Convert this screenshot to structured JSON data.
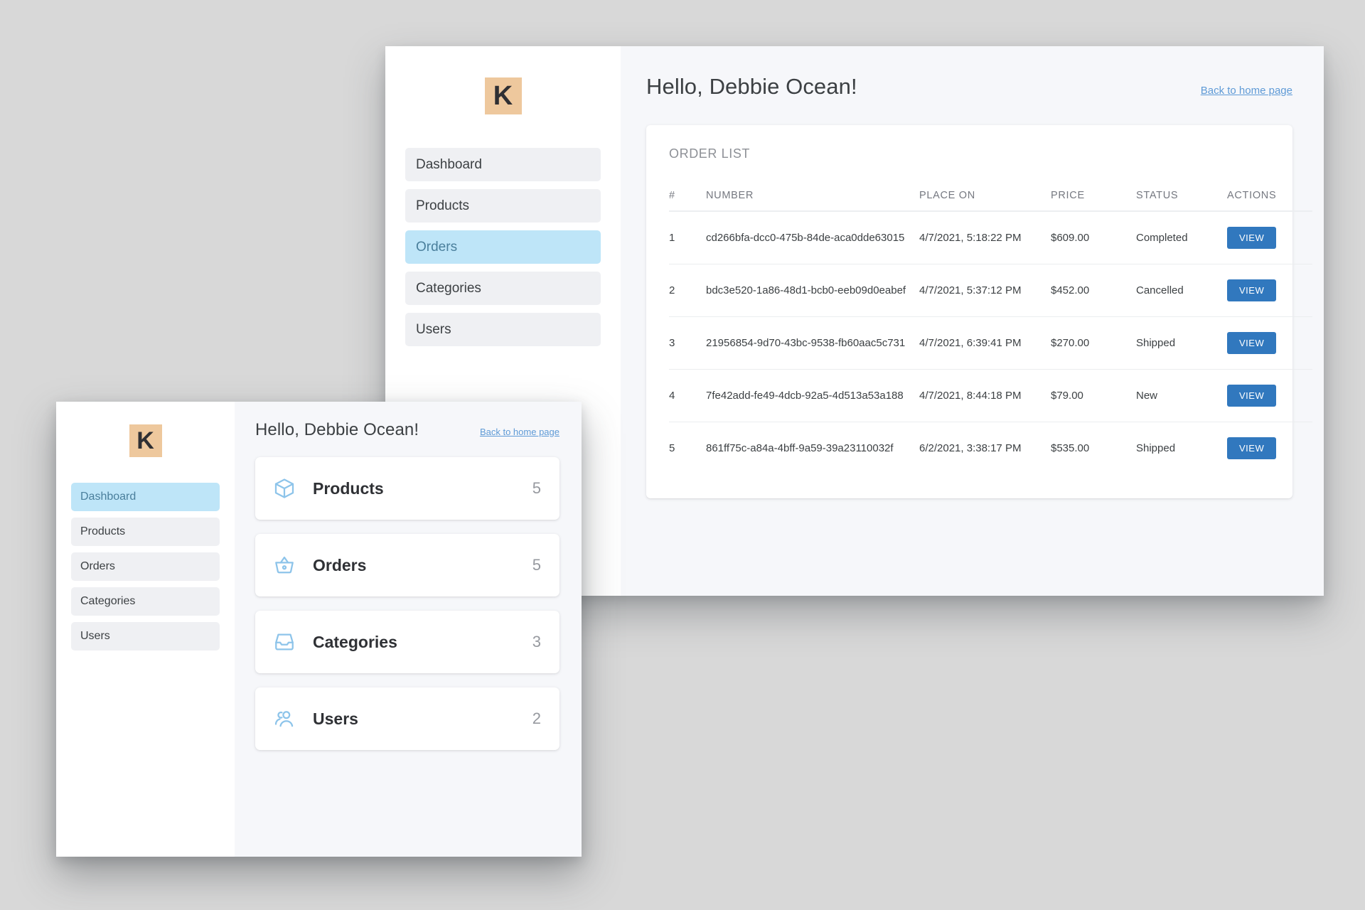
{
  "brand": {
    "logo_letter": "K",
    "logo_bg": "#eec89d",
    "accent_blue": "#3178be",
    "link_blue": "#5e9ad6",
    "active_nav_bg": "#bee5f8"
  },
  "orders_window": {
    "sidebar": {
      "items": [
        {
          "label": "Dashboard",
          "active": false
        },
        {
          "label": "Products",
          "active": false
        },
        {
          "label": "Orders",
          "active": true
        },
        {
          "label": "Categories",
          "active": false
        },
        {
          "label": "Users",
          "active": false
        }
      ]
    },
    "header": {
      "greeting": "Hello, Debbie Ocean!",
      "home_link": "Back to home page"
    },
    "card": {
      "title": "ORDER LIST",
      "columns": [
        "#",
        "NUMBER",
        "PLACE ON",
        "PRICE",
        "STATUS",
        "ACTIONS"
      ],
      "action_label": "VIEW",
      "rows": [
        {
          "idx": "1",
          "number": "cd266bfa-dcc0-475b-84de-aca0dde63015",
          "placed": "4/7/2021, 5:18:22 PM",
          "price": "$609.00",
          "status": "Completed"
        },
        {
          "idx": "2",
          "number": "bdc3e520-1a86-48d1-bcb0-eeb09d0eabef",
          "placed": "4/7/2021, 5:37:12 PM",
          "price": "$452.00",
          "status": "Cancelled"
        },
        {
          "idx": "3",
          "number": "21956854-9d70-43bc-9538-fb60aac5c731",
          "placed": "4/7/2021, 6:39:41 PM",
          "price": "$270.00",
          "status": "Shipped"
        },
        {
          "idx": "4",
          "number": "7fe42add-fe49-4dcb-92a5-4d513a53a188",
          "placed": "4/7/2021, 8:44:18 PM",
          "price": "$79.00",
          "status": "New"
        },
        {
          "idx": "5",
          "number": "861ff75c-a84a-4bff-9a59-39a23110032f",
          "placed": "6/2/2021, 3:38:17 PM",
          "price": "$535.00",
          "status": "Shipped"
        }
      ]
    }
  },
  "dashboard_window": {
    "sidebar": {
      "items": [
        {
          "label": "Dashboard",
          "active": true
        },
        {
          "label": "Products",
          "active": false
        },
        {
          "label": "Orders",
          "active": false
        },
        {
          "label": "Categories",
          "active": false
        },
        {
          "label": "Users",
          "active": false
        }
      ]
    },
    "header": {
      "greeting": "Hello, Debbie Ocean!",
      "home_link": "Back to home page"
    },
    "stats": [
      {
        "label": "Products",
        "count": "5",
        "icon": "cube-icon"
      },
      {
        "label": "Orders",
        "count": "5",
        "icon": "basket-icon"
      },
      {
        "label": "Categories",
        "count": "3",
        "icon": "inbox-icon"
      },
      {
        "label": "Users",
        "count": "2",
        "icon": "users-icon"
      }
    ]
  }
}
